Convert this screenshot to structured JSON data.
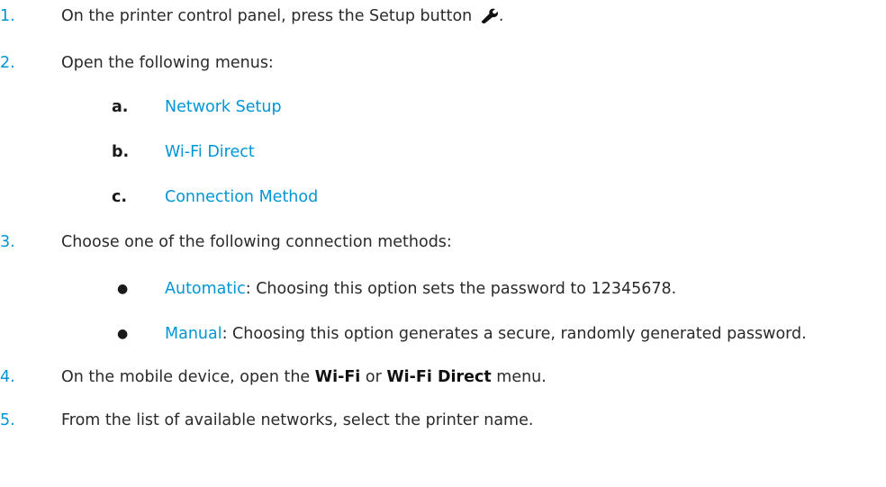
{
  "steps": [
    {
      "number": "1.",
      "text_before_icon": "On the printer control panel, press the Setup button",
      "icon": "wrench-icon",
      "text_after_icon": "."
    },
    {
      "number": "2.",
      "text": "Open the following menus:",
      "substeps": [
        {
          "letter": "a.",
          "text": "Network Setup"
        },
        {
          "letter": "b.",
          "text": "Wi-Fi Direct"
        },
        {
          "letter": "c.",
          "text": "Connection Method"
        }
      ]
    },
    {
      "number": "3.",
      "text": "Choose one of the following connection methods:",
      "bullets": [
        {
          "term": "Automatic",
          "description": ": Choosing this option sets the password to 12345678."
        },
        {
          "term": "Manual",
          "description": ": Choosing this option generates a secure, randomly generated password."
        }
      ]
    },
    {
      "number": "4.",
      "text_part1": "On the mobile device, open the ",
      "bold1": "Wi-Fi",
      "text_part2": " or ",
      "bold2": "Wi-Fi Direct",
      "text_part3": " menu."
    },
    {
      "number": "5.",
      "text": "From the list of available networks, select the printer name."
    }
  ],
  "bullet_glyph": "●",
  "colors": {
    "accent": "#0096d6",
    "text": "#2a2a2a"
  }
}
